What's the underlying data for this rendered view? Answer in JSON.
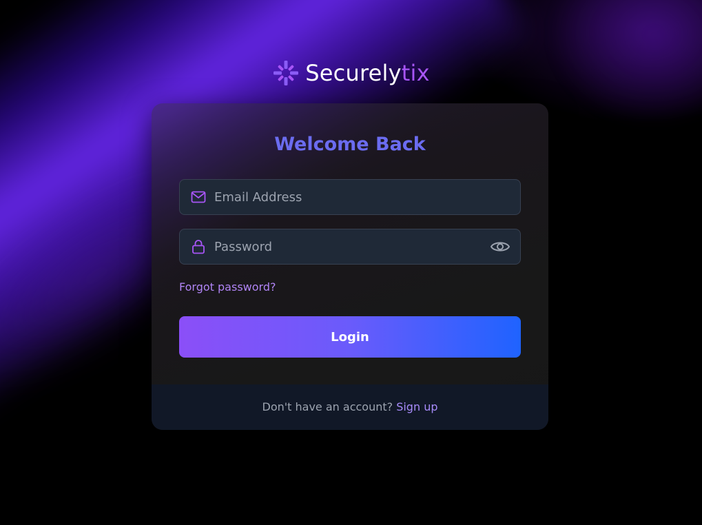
{
  "brand": {
    "name": "Securely",
    "accent": "tix",
    "logo_icon": "sparkle-burst-icon"
  },
  "login_form": {
    "title": "Welcome Back",
    "email": {
      "placeholder": "Email Address",
      "value": "",
      "icon": "mail-icon"
    },
    "password": {
      "placeholder": "Password",
      "value": "",
      "icon": "lock-icon",
      "toggle_icon": "eye-icon"
    },
    "forgot_password_label": "Forgot password?",
    "login_label": "Login"
  },
  "footer": {
    "prompt": "Don't have an account?",
    "signup_label": "Sign up"
  },
  "colors": {
    "accent_purple": "#a855f7",
    "title_indigo": "#6b6cf0",
    "button_gradient_start": "#8b4ff8",
    "button_gradient_end": "#1f63ff",
    "field_background": "#1f2937",
    "footer_background": "#111827"
  }
}
